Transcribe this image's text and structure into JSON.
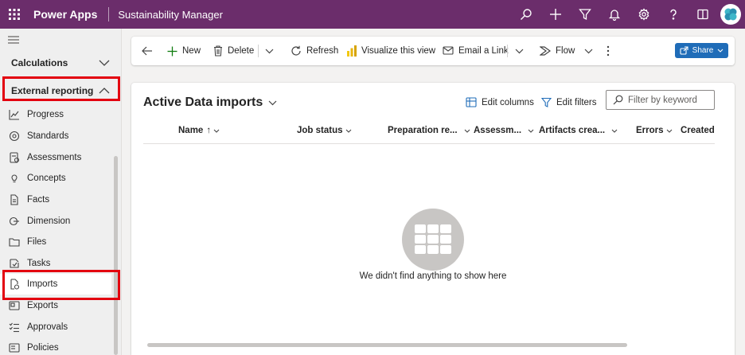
{
  "topbar": {
    "app_name": "Power Apps",
    "app_title": "Sustainability Manager",
    "icons": [
      "search-icon",
      "add-icon",
      "filter-icon",
      "bell-icon",
      "settings-icon",
      "help-icon",
      "reading-icon",
      "avatar"
    ],
    "brand_color": "#6b2d6b"
  },
  "sidebar": {
    "groups": [
      {
        "label": "Calculations",
        "state": "collapsed"
      },
      {
        "label": "External reporting",
        "state": "expanded"
      }
    ],
    "items": [
      {
        "label": "Progress",
        "icon": "chart-line-icon"
      },
      {
        "label": "Standards",
        "icon": "standards-icon"
      },
      {
        "label": "Assessments",
        "icon": "assessment-icon"
      },
      {
        "label": "Concepts",
        "icon": "lightbulb-icon"
      },
      {
        "label": "Facts",
        "icon": "document-icon"
      },
      {
        "label": "Dimension",
        "icon": "dimension-icon"
      },
      {
        "label": "Files",
        "icon": "folder-icon"
      },
      {
        "label": "Tasks",
        "icon": "tasks-icon"
      },
      {
        "label": "Imports",
        "icon": "import-icon",
        "active": true
      },
      {
        "label": "Exports",
        "icon": "export-icon"
      },
      {
        "label": "Approvals",
        "icon": "approvals-icon"
      },
      {
        "label": "Policies",
        "icon": "policies-icon"
      }
    ]
  },
  "commandbar": {
    "new": "New",
    "delete": "Delete",
    "refresh": "Refresh",
    "visualize": "Visualize this view",
    "email": "Email a Link",
    "flow": "Flow",
    "share": "Share"
  },
  "view": {
    "title": "Active Data imports",
    "edit_columns": "Edit columns",
    "edit_filters": "Edit filters",
    "search_placeholder": "Filter by keyword",
    "columns": [
      "Name",
      "Job status",
      "Preparation re...",
      "Assessm...",
      "Artifacts crea...",
      "Errors",
      "Created O"
    ],
    "sort_indicator": "↑",
    "empty_message": "We didn't find anything to show here"
  }
}
